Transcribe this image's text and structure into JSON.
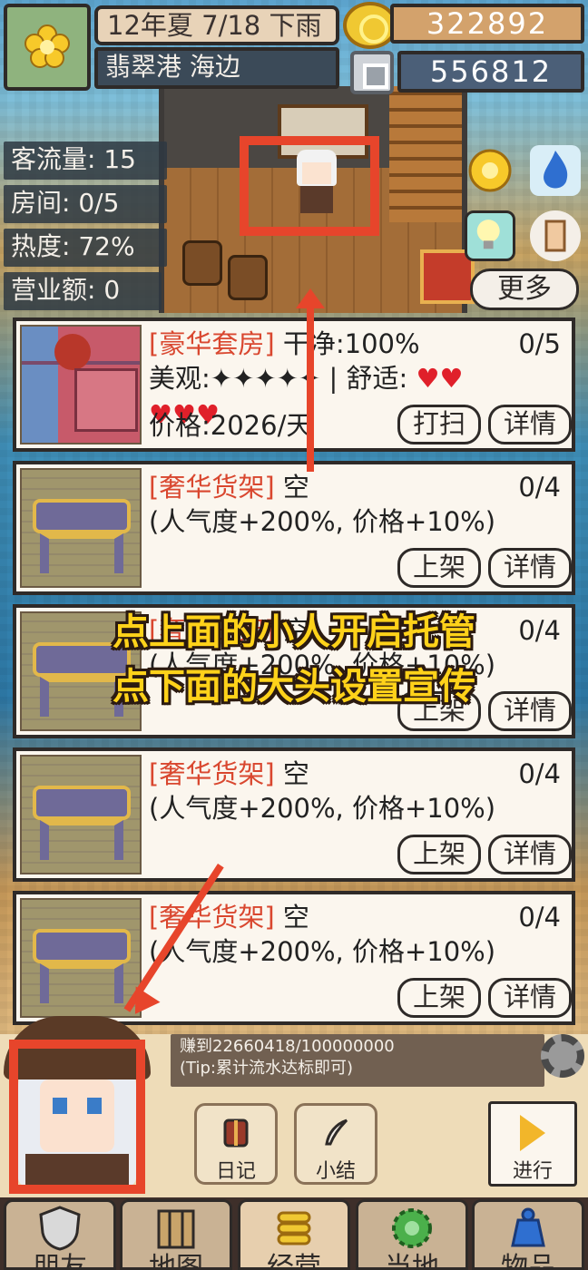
{
  "header": {
    "date": "12年夏 7/18 下雨",
    "location": "翡翠港 海边",
    "gold": "322892",
    "gems": "556812"
  },
  "stats": {
    "traffic": "客流量: 15",
    "rooms": "房间: 0/5",
    "heat": "热度: 72%",
    "revenue": "营业额: 0"
  },
  "more_label": "更多",
  "cards": [
    {
      "tag": "[豪华套房]",
      "title_rest": " 干净:100%",
      "count": "0/5",
      "line2": "美观:✦✦✦✦✦ | 舒适: ",
      "hearts_line2": "♥♥",
      "hearts_line3": "♥♥♥",
      "line3": "价格:2026/天",
      "btn1": "打扫",
      "btn2": "详情"
    },
    {
      "tag": "[奢华货架]",
      "title_rest": " 空",
      "count": "0/4",
      "line2": "(人气度+200%, 价格+10%)",
      "btn1": "上架",
      "btn2": "详情"
    },
    {
      "tag": "[奢华货架]",
      "title_rest": " 空",
      "count": "0/4",
      "line2": "(人气度+200%, 价格+10%)",
      "btn1": "上架",
      "btn2": "详情"
    },
    {
      "tag": "[奢华货架]",
      "title_rest": " 空",
      "count": "0/4",
      "line2": "(人气度+200%, 价格+10%)",
      "btn1": "上架",
      "btn2": "详情"
    },
    {
      "tag": "[奢华货架]",
      "title_rest": " 空",
      "count": "0/4",
      "line2": "(人气度+200%, 价格+10%)",
      "btn1": "上架",
      "btn2": "详情"
    }
  ],
  "overlay": {
    "line1": "点上面的小人开启托管",
    "line2": "点下面的大头设置宣传"
  },
  "progress": {
    "earned": "赚到22660418/100000000",
    "tip": "(Tip:累计流水达标即可)"
  },
  "actions": {
    "diary": "日记",
    "summary": "小结",
    "proceed": "进行"
  },
  "tabs": [
    "朋友",
    "地图",
    "经营",
    "当地",
    "物品"
  ],
  "colors": {
    "accent_red": "#e7452b",
    "overlay_text": "#ffd21a",
    "tag_red": "#d9472f"
  }
}
